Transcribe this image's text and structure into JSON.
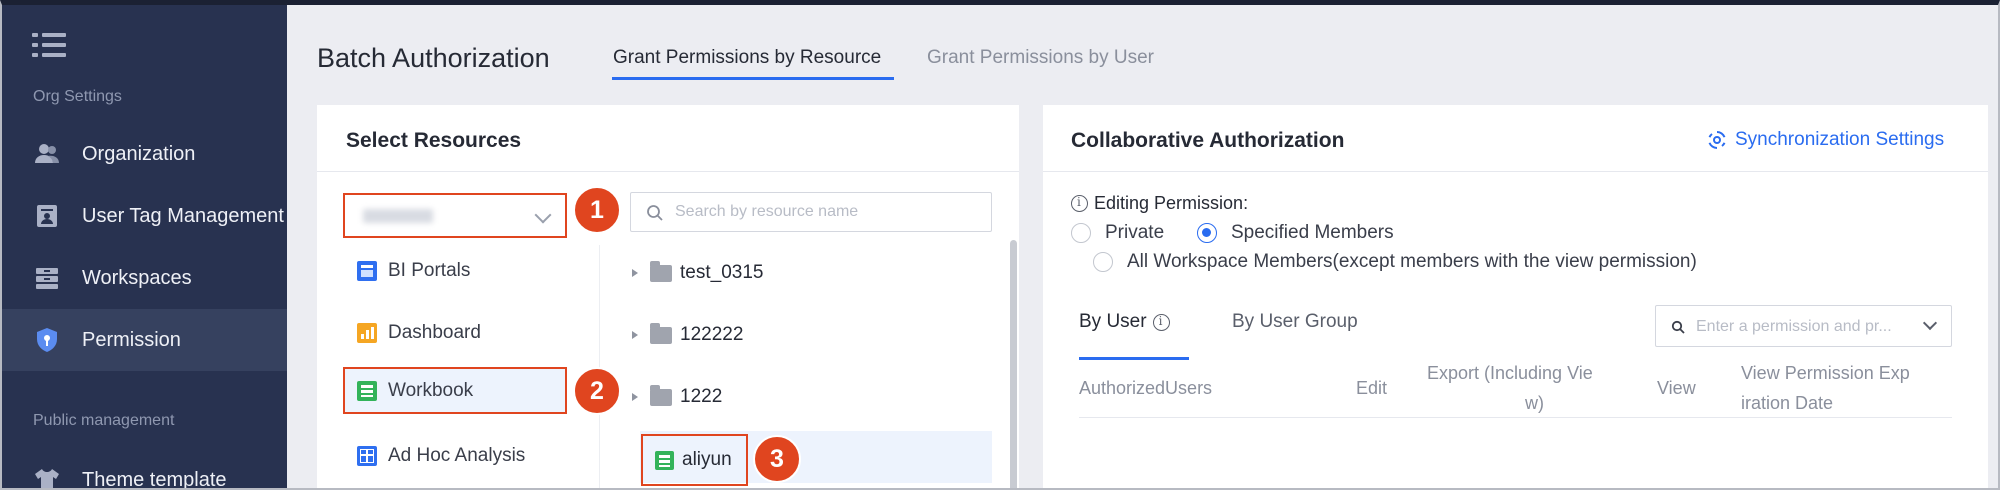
{
  "sidebar": {
    "section_org": "Org Settings",
    "section_public": "Public management",
    "items": [
      {
        "label": "Organization",
        "icon": "organization-icon"
      },
      {
        "label": "User Tag Management",
        "icon": "user-tag-icon"
      },
      {
        "label": "Workspaces",
        "icon": "workspaces-icon"
      },
      {
        "label": "Permission",
        "icon": "shield-icon"
      },
      {
        "label": "Theme template",
        "icon": "shirt-icon"
      }
    ],
    "active_item": "Permission"
  },
  "header": {
    "title": "Batch Authorization",
    "tabs": [
      {
        "label": "Grant Permissions by Resource",
        "active": true
      },
      {
        "label": "Grant Permissions by User",
        "active": false
      }
    ]
  },
  "select_resources": {
    "title": "Select Resources",
    "search_placeholder": "Search by resource name",
    "categories": [
      {
        "label": "BI Portals",
        "color": "#2f6ff0"
      },
      {
        "label": "Dashboard",
        "color": "#f5a623"
      },
      {
        "label": "Workbook",
        "color": "#33b35a"
      },
      {
        "label": "Ad Hoc Analysis",
        "color": "#2f6ff0"
      }
    ],
    "tree": [
      "test_0315",
      "122222",
      "1222",
      "aliyun"
    ],
    "badges": [
      "1",
      "2",
      "3"
    ]
  },
  "collab": {
    "title": "Collaborative Authorization",
    "sync_label": "Synchronization Settings",
    "editing_permission_label": "Editing Permission:",
    "options": [
      "Private",
      "Specified Members",
      "All Workspace Members(except members with the view permission)"
    ],
    "selected_option": "Specified Members",
    "subtabs": [
      "By User",
      "By User Group"
    ],
    "perm_search_placeholder": "Enter a permission and pr...",
    "columns": {
      "users": "AuthorizedUsers",
      "edit": "Edit",
      "export_line1": "Export (Including Vie",
      "export_line2": "w)",
      "view": "View",
      "expiry_line1": "View Permission Exp",
      "expiry_line2": "iration Date"
    }
  },
  "colors": {
    "accent": "#2a6cf0",
    "highlight": "#e0451f",
    "sidebar": "#283250"
  }
}
